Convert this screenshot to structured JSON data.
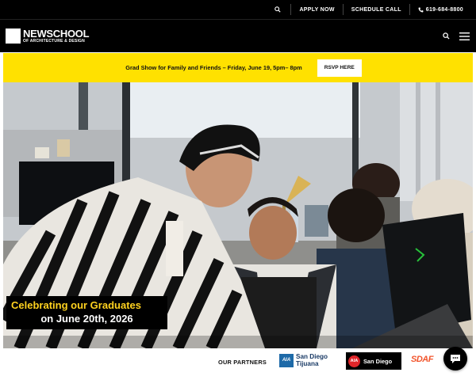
{
  "utility_bar": {
    "search_icon": "search-icon",
    "apply_now": "APPLY NOW",
    "schedule_call": "SCHEDULE CALL",
    "phone_icon": "phone-icon",
    "phone": "619-684-8800"
  },
  "header": {
    "logo_main": "NEWSCHOOL",
    "logo_sub": "OF ARCHITECTURE & DESIGN",
    "search_icon": "search-icon",
    "menu_icon": "hamburger-menu-icon"
  },
  "announcement": {
    "text": "Grad Show for Family and Friends – Friday, June 19, 5pm– 8pm",
    "button": "RSVP HERE",
    "background": "#ffe100"
  },
  "hero": {
    "caption_line1": "Celebrating our Graduates",
    "caption_line2": "on June 20th, 2026",
    "caption_line1_color": "#ffd21f"
  },
  "partners": {
    "label": "OUR PARTNERS",
    "aia_sd_tj_badge": "AIA",
    "aia_sd_tj_line1": "San Diego",
    "aia_sd_tj_line2": "Tijuana",
    "aia_sd_badge": "AIA",
    "aia_sd_text": "San Diego",
    "sdaf": "SDAF"
  },
  "chat": {
    "icon": "chat-bubble-icon"
  }
}
